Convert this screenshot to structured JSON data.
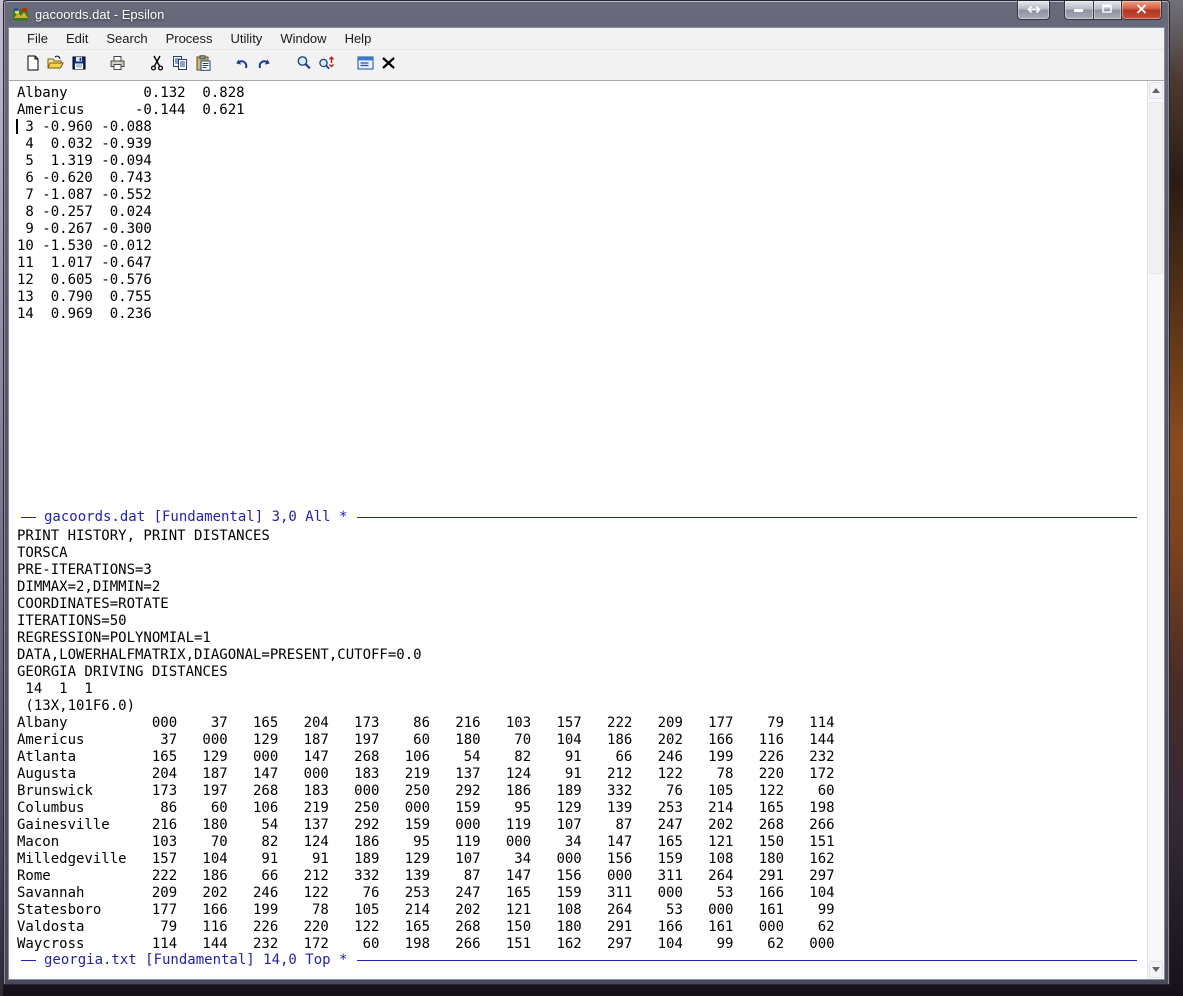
{
  "window": {
    "title": "gacoords.dat - Epsilon"
  },
  "menu": {
    "items": [
      {
        "label": "File"
      },
      {
        "label": "Edit"
      },
      {
        "label": "Search"
      },
      {
        "label": "Process"
      },
      {
        "label": "Utility"
      },
      {
        "label": "Window"
      },
      {
        "label": "Help"
      }
    ]
  },
  "toolbar": {
    "groups": [
      [
        "new-file",
        "open-file",
        "save-file"
      ],
      [
        "print"
      ],
      [
        "cut",
        "copy",
        "paste"
      ],
      [
        "undo",
        "redo"
      ],
      [
        "find",
        "find-replace"
      ],
      [
        "buffer-list",
        "delete"
      ]
    ]
  },
  "buffers": {
    "top": {
      "rows": [
        {
          "kind": "name",
          "label": "Albany",
          "x": "0.132",
          "y": "0.828"
        },
        {
          "kind": "name",
          "label": "Americus",
          "x": "-0.144",
          "y": "0.621"
        },
        {
          "kind": "num",
          "label": "3",
          "x": "-0.960",
          "y": "-0.088"
        },
        {
          "kind": "num",
          "label": "4",
          "x": "0.032",
          "y": "-0.939"
        },
        {
          "kind": "num",
          "label": "5",
          "x": "1.319",
          "y": "-0.094"
        },
        {
          "kind": "num",
          "label": "6",
          "x": "-0.620",
          "y": "0.743"
        },
        {
          "kind": "num",
          "label": "7",
          "x": "-1.087",
          "y": "-0.552"
        },
        {
          "kind": "num",
          "label": "8",
          "x": "-0.257",
          "y": "0.024"
        },
        {
          "kind": "num",
          "label": "9",
          "x": "-0.267",
          "y": "-0.300"
        },
        {
          "kind": "num",
          "label": "10",
          "x": "-1.530",
          "y": "-0.012"
        },
        {
          "kind": "num",
          "label": "11",
          "x": "1.017",
          "y": "-0.647"
        },
        {
          "kind": "num",
          "label": "12",
          "x": "0.605",
          "y": "-0.576"
        },
        {
          "kind": "num",
          "label": "13",
          "x": "0.790",
          "y": "0.755"
        },
        {
          "kind": "num",
          "label": "14",
          "x": "0.969",
          "y": "0.236"
        }
      ]
    },
    "modeline_top": {
      "buffer": "gacoords.dat",
      "mode": "[Fundamental]",
      "position": "3,0",
      "scope": "All",
      "modified": "*"
    },
    "bottom": {
      "header_lines": [
        "PRINT HISTORY, PRINT DISTANCES",
        "TORSCA",
        "PRE-ITERATIONS=3",
        "DIMMAX=2,DIMMIN=2",
        "COORDINATES=ROTATE",
        "ITERATIONS=50",
        "REGRESSION=POLYNOMIAL=1",
        "DATA,LOWERHALFMATRIX,DIAGONAL=PRESENT,CUTOFF=0.0",
        "GEORGIA DRIVING DISTANCES",
        " 14  1  1",
        " (13X,101F6.0)"
      ],
      "matrix": {
        "cities": [
          "Albany",
          "Americus",
          "Atlanta",
          "Augusta",
          "Brunswick",
          "Columbus",
          "Gainesville",
          "Macon",
          "Milledgeville",
          "Rome",
          "Savannah",
          "Statesboro",
          "Valdosta",
          "Waycross"
        ],
        "distances": [
          [
            "000",
            "37",
            "165",
            "204",
            "173",
            "86",
            "216",
            "103",
            "157",
            "222",
            "209",
            "177",
            "79",
            "114"
          ],
          [
            "37",
            "000",
            "129",
            "187",
            "197",
            "60",
            "180",
            "70",
            "104",
            "186",
            "202",
            "166",
            "116",
            "144"
          ],
          [
            "165",
            "129",
            "000",
            "147",
            "268",
            "106",
            "54",
            "82",
            "91",
            "66",
            "246",
            "199",
            "226",
            "232"
          ],
          [
            "204",
            "187",
            "147",
            "000",
            "183",
            "219",
            "137",
            "124",
            "91",
            "212",
            "122",
            "78",
            "220",
            "172"
          ],
          [
            "173",
            "197",
            "268",
            "183",
            "000",
            "250",
            "292",
            "186",
            "189",
            "332",
            "76",
            "105",
            "122",
            "60"
          ],
          [
            "86",
            "60",
            "106",
            "219",
            "250",
            "000",
            "159",
            "95",
            "129",
            "139",
            "253",
            "214",
            "165",
            "198"
          ],
          [
            "216",
            "180",
            "54",
            "137",
            "292",
            "159",
            "000",
            "119",
            "107",
            "87",
            "247",
            "202",
            "268",
            "266"
          ],
          [
            "103",
            "70",
            "82",
            "124",
            "186",
            "95",
            "119",
            "000",
            "34",
            "147",
            "165",
            "121",
            "150",
            "151"
          ],
          [
            "157",
            "104",
            "91",
            "91",
            "189",
            "129",
            "107",
            "34",
            "000",
            "156",
            "159",
            "108",
            "180",
            "162"
          ],
          [
            "222",
            "186",
            "66",
            "212",
            "332",
            "139",
            "87",
            "147",
            "156",
            "000",
            "311",
            "264",
            "291",
            "297"
          ],
          [
            "209",
            "202",
            "246",
            "122",
            "76",
            "253",
            "247",
            "165",
            "159",
            "311",
            "000",
            "53",
            "166",
            "104"
          ],
          [
            "177",
            "166",
            "199",
            "78",
            "105",
            "214",
            "202",
            "121",
            "108",
            "264",
            "53",
            "000",
            "161",
            "99"
          ],
          [
            "79",
            "116",
            "226",
            "220",
            "122",
            "165",
            "268",
            "150",
            "180",
            "291",
            "166",
            "161",
            "000",
            "62"
          ],
          [
            "114",
            "144",
            "232",
            "172",
            "60",
            "198",
            "266",
            "151",
            "162",
            "297",
            "104",
            "99",
            "62",
            "000"
          ]
        ]
      }
    },
    "modeline_bottom": {
      "buffer": "georgia.txt",
      "mode": "[Fundamental]",
      "position": "14,0",
      "scope": "Top",
      "modified": "*"
    }
  },
  "colors": {
    "modeline_text": "#2222aa",
    "titlebar": "#565868",
    "close_button": "#c0402c",
    "editor_background": "#ffffff",
    "chrome_background": "#f2f2f2"
  }
}
